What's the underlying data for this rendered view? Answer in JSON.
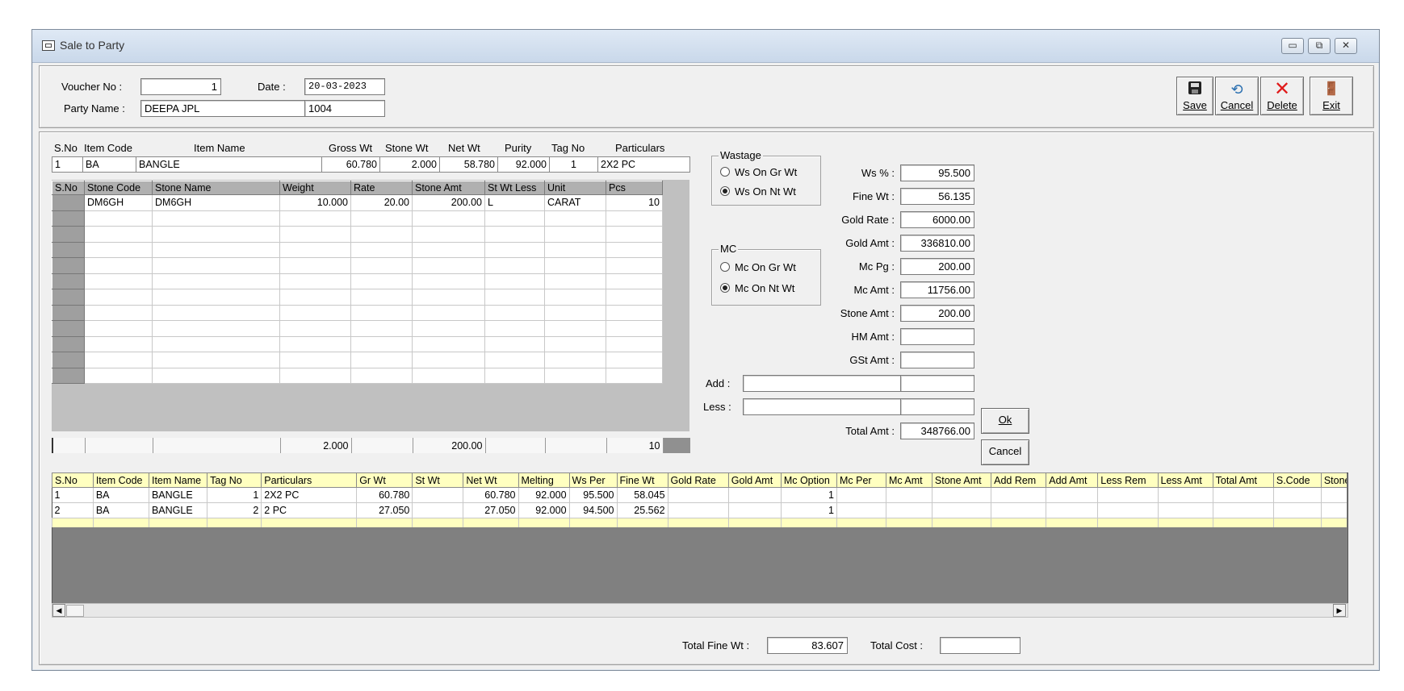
{
  "window": {
    "title": "Sale to Party",
    "minimize": "▭",
    "restore": "⧉",
    "close": "✕"
  },
  "header": {
    "voucher_label": "Voucher No :",
    "voucher_value": "1",
    "date_label": "Date :",
    "date_value": "20-03-2023",
    "party_label": "Party Name :",
    "party_name": "DEEPA JPL",
    "party_code": "1004"
  },
  "toolbar": {
    "save": "Save",
    "cancel": "Cancel",
    "delete": "Delete",
    "exit": "Exit",
    "icons": [
      "floppy-disk-icon",
      "undo-icon",
      "red-x-icon",
      "door-exit-icon"
    ]
  },
  "item_header": {
    "cols": [
      "S.No",
      "Item Code",
      "Item Name",
      "Gross Wt",
      "Stone Wt",
      "Net Wt",
      "Purity",
      "Tag No",
      "Particulars"
    ],
    "row": [
      "1",
      "BA",
      "BANGLE",
      "60.780",
      "2.000",
      "58.780",
      "92.000",
      "1",
      "2X2 PC"
    ]
  },
  "stone_grid": {
    "cols": [
      "S.No",
      "Stone Code",
      "Stone Name",
      "Weight",
      "Rate",
      "Stone Amt",
      "St Wt Less",
      "Unit",
      "Pcs"
    ],
    "rows": [
      [
        "",
        "DM6GH",
        "DM6GH",
        "10.000",
        "20.00",
        "200.00",
        "L",
        "CARAT",
        "10"
      ]
    ],
    "totals": [
      "",
      "",
      "",
      "2.000",
      "",
      "200.00",
      "",
      "",
      "10"
    ]
  },
  "wastage": {
    "title": "Wastage",
    "opt1": "Ws On Gr Wt",
    "opt2": "Ws On Nt Wt",
    "selected": "opt2"
  },
  "mc": {
    "title": "MC",
    "opt1": "Mc On Gr Wt",
    "opt2": "Mc On Nt Wt",
    "selected": "opt2"
  },
  "calc": {
    "ws_pct_label": "Ws % :",
    "ws_pct": "95.500",
    "fine_wt_label": "Fine Wt :",
    "fine_wt": "56.135",
    "gold_rate_label": "Gold Rate :",
    "gold_rate": "6000.00",
    "gold_amt_label": "Gold Amt :",
    "gold_amt": "336810.00",
    "mc_pg_label": "Mc Pg :",
    "mc_pg": "200.00",
    "mc_amt_label": "Mc Amt :",
    "mc_amt": "11756.00",
    "stone_amt_label": "Stone Amt :",
    "stone_amt": "200.00",
    "hm_amt_label": "HM Amt :",
    "hm_amt": "",
    "gst_amt_label": "GSt Amt :",
    "gst_amt": "",
    "add_label": "Add :",
    "less_label": "Less :",
    "total_amt_label": "Total Amt :",
    "total_amt": "348766.00",
    "ok": "Ok",
    "cancel": "Cancel"
  },
  "bottom_grid": {
    "cols": [
      "S.No",
      "Item Code",
      "Item Name",
      "Tag No",
      "Particulars",
      "Gr Wt",
      "St Wt",
      "Net Wt",
      "Melting",
      "Ws Per",
      "Fine Wt",
      "Gold Rate",
      "Gold Amt",
      "Mc Option",
      "Mc Per",
      "Mc Amt",
      "Stone Amt",
      "Add Rem",
      "Add Amt",
      "Less Rem",
      "Less Amt",
      "Total Amt",
      "S.Code",
      "Stone Na"
    ],
    "rows": [
      [
        "1",
        "BA",
        "BANGLE",
        "1",
        "2X2 PC",
        "60.780",
        "",
        "60.780",
        "92.000",
        "95.500",
        "58.045",
        "",
        "",
        "1",
        "",
        "",
        "",
        "",
        "",
        "",
        "",
        "",
        "",
        ""
      ],
      [
        "2",
        "BA",
        "BANGLE",
        "2",
        "2 PC",
        "27.050",
        "",
        "27.050",
        "92.000",
        "94.500",
        "25.562",
        "",
        "",
        "1",
        "",
        "",
        "",
        "",
        "",
        "",
        "",
        "",
        "",
        ""
      ]
    ]
  },
  "footer": {
    "total_fine_label": "Total Fine Wt :",
    "total_fine": "83.607",
    "total_cost_label": "Total Cost :",
    "total_cost": ""
  }
}
